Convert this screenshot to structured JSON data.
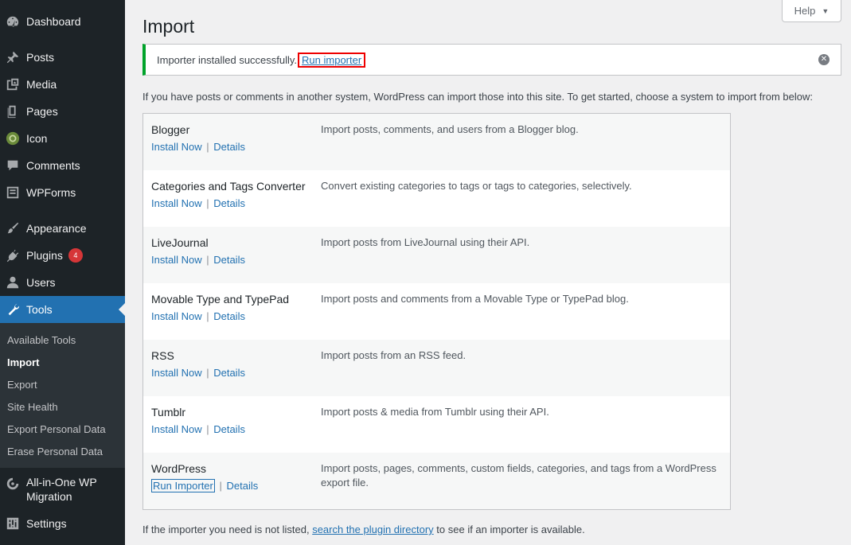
{
  "sidebar": {
    "items": [
      {
        "label": "Dashboard",
        "icon": "dashboard-icon"
      },
      {
        "label": "Posts",
        "icon": "pin-icon"
      },
      {
        "label": "Media",
        "icon": "media-icon"
      },
      {
        "label": "Pages",
        "icon": "pages-icon"
      },
      {
        "label": "Icon",
        "icon": "gear-circle-icon"
      },
      {
        "label": "Comments",
        "icon": "comment-icon"
      },
      {
        "label": "WPForms",
        "icon": "forms-icon"
      },
      {
        "label": "Appearance",
        "icon": "brush-icon"
      },
      {
        "label": "Plugins",
        "icon": "plugin-icon",
        "badge": "4"
      },
      {
        "label": "Users",
        "icon": "user-icon"
      },
      {
        "label": "Tools",
        "icon": "wrench-icon"
      },
      {
        "label": "All-in-One WP Migration",
        "icon": "migration-icon"
      },
      {
        "label": "Settings",
        "icon": "settings-icon"
      }
    ],
    "submenu": [
      "Available Tools",
      "Import",
      "Export",
      "Site Health",
      "Export Personal Data",
      "Erase Personal Data"
    ]
  },
  "header": {
    "title": "Import",
    "help_label": "Help",
    "help_caret": "▼"
  },
  "notice": {
    "message": "Importer installed successfully.",
    "link": "Run importer",
    "dismiss": "✕"
  },
  "intro": "If you have posts or comments in another system, WordPress can import those into this site. To get started, choose a system to import from below:",
  "importers": [
    {
      "name": "Blogger",
      "action": "Install Now",
      "details": "Details",
      "desc": "Import posts, comments, and users from a Blogger blog."
    },
    {
      "name": "Categories and Tags Converter",
      "action": "Install Now",
      "details": "Details",
      "desc": "Convert existing categories to tags or tags to categories, selectively."
    },
    {
      "name": "LiveJournal",
      "action": "Install Now",
      "details": "Details",
      "desc": "Import posts from LiveJournal using their API."
    },
    {
      "name": "Movable Type and TypePad",
      "action": "Install Now",
      "details": "Details",
      "desc": "Import posts and comments from a Movable Type or TypePad blog."
    },
    {
      "name": "RSS",
      "action": "Install Now",
      "details": "Details",
      "desc": "Import posts from an RSS feed."
    },
    {
      "name": "Tumblr",
      "action": "Install Now",
      "details": "Details",
      "desc": "Import posts & media from Tumblr using their API."
    },
    {
      "name": "WordPress",
      "action": "Run Importer",
      "details": "Details",
      "desc": "Import posts, pages, comments, custom fields, categories, and tags from a WordPress export file."
    }
  ],
  "separator": "|",
  "footer": {
    "before": "If the importer you need is not listed,",
    "link": "search the plugin directory",
    "after": "to see if an importer is available."
  }
}
